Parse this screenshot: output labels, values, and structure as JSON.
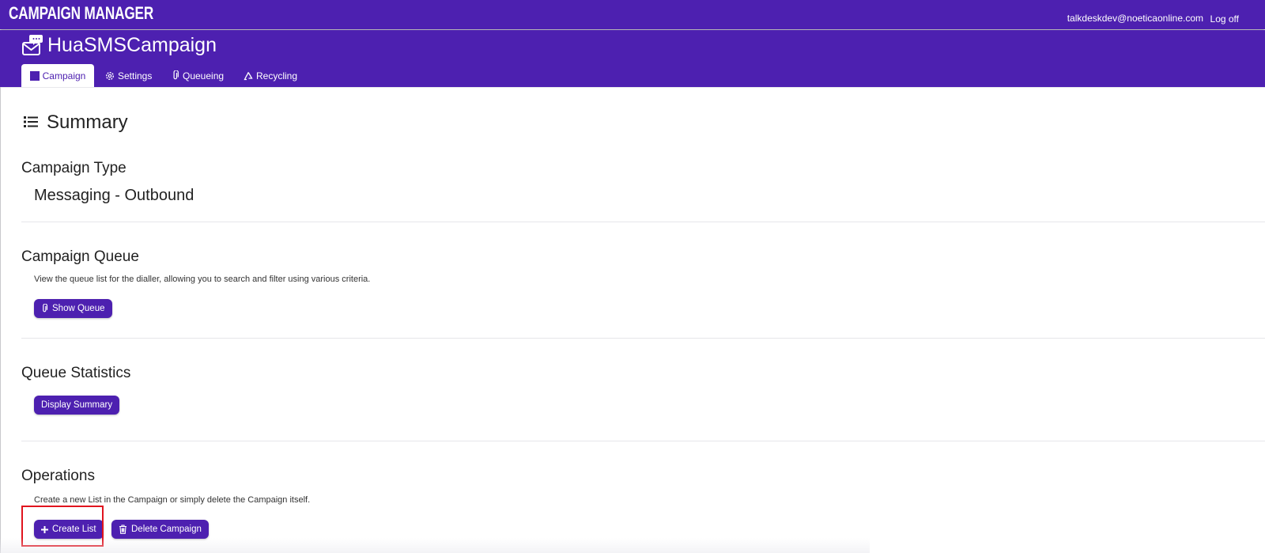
{
  "app": {
    "brand": "CAMPAIGN MANAGER"
  },
  "user": {
    "email": "talkdeskdev@noeticaonline.com",
    "logoff_label": "Log off"
  },
  "campaign": {
    "name": "HuaSMSCampaign"
  },
  "tabs": [
    {
      "label": "Campaign",
      "icon": "square-icon",
      "active": true
    },
    {
      "label": "Settings",
      "icon": "gear-icon"
    },
    {
      "label": "Queueing",
      "icon": "paperclip-icon"
    },
    {
      "label": "Recycling",
      "icon": "recycle-icon"
    }
  ],
  "summary": {
    "title": "Summary",
    "icon": "list-icon"
  },
  "sections": {
    "campaign_type": {
      "title": "Campaign Type",
      "value": "Messaging - Outbound"
    },
    "campaign_queue": {
      "title": "Campaign Queue",
      "description": "View the queue list for the dialler, allowing you to search and filter using various criteria.",
      "button": "Show Queue"
    },
    "queue_statistics": {
      "title": "Queue Statistics",
      "button": "Display Summary"
    },
    "operations": {
      "title": "Operations",
      "description": "Create a new List in the Campaign or simply delete the Campaign itself.",
      "create_button": "Create List",
      "delete_button": "Delete Campaign"
    }
  },
  "colors": {
    "primary": "#4d20b0",
    "highlight": "#e0141e"
  }
}
